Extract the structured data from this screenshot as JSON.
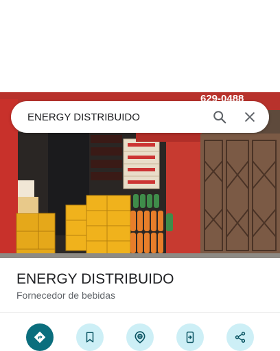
{
  "search": {
    "query": "ENERGY DISTRIBUIDO",
    "search_icon": "search-icon",
    "close_icon": "close-icon"
  },
  "photo": {
    "sign_text": "629-0488"
  },
  "place": {
    "name": "ENERGY DISTRIBUIDO",
    "category": "Fornecedor de bebidas"
  },
  "actions": [
    {
      "icon": "directions-icon",
      "primary": true
    },
    {
      "icon": "bookmark-icon",
      "primary": false
    },
    {
      "icon": "location-pin-icon",
      "primary": false
    },
    {
      "icon": "send-to-phone-icon",
      "primary": false
    },
    {
      "icon": "share-icon",
      "primary": false
    }
  ],
  "colors": {
    "primary_action": "#0b6e7d",
    "secondary_action": "#cdeff6",
    "secondary_icon": "#0b5563",
    "title": "#202124",
    "subtitle": "#5f6368"
  }
}
